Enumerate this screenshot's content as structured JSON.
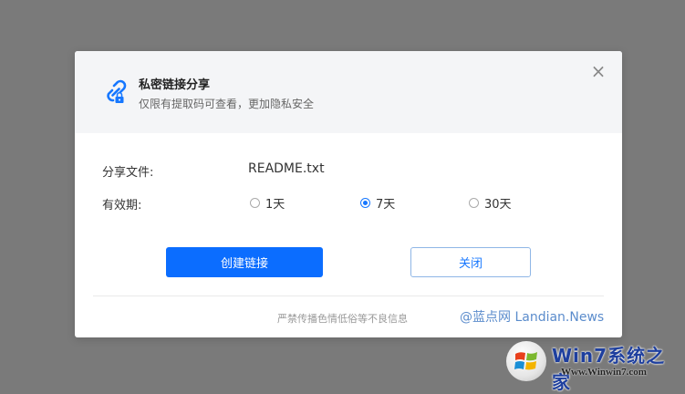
{
  "dialog": {
    "title": "私密链接分享",
    "subtitle": "仅限有提取码可查看，更加隐私安全",
    "close_glyph": "×",
    "file_label": "分享文件:",
    "file_name": "README.txt",
    "validity_label": "有效期:",
    "options": [
      {
        "label": "1天",
        "selected": false
      },
      {
        "label": "7天",
        "selected": true
      },
      {
        "label": "30天",
        "selected": false
      }
    ],
    "create_button": "创建链接",
    "close_button": "关闭",
    "footer_note": "严禁传播色情低俗等不良信息"
  },
  "watermark": "@蓝点网 Landian.News",
  "brand": {
    "name": "Win7系统之家",
    "url": "Www.Winwin7.com"
  },
  "colors": {
    "accent": "#0b6dff",
    "overlay": "#7a7a7a"
  }
}
